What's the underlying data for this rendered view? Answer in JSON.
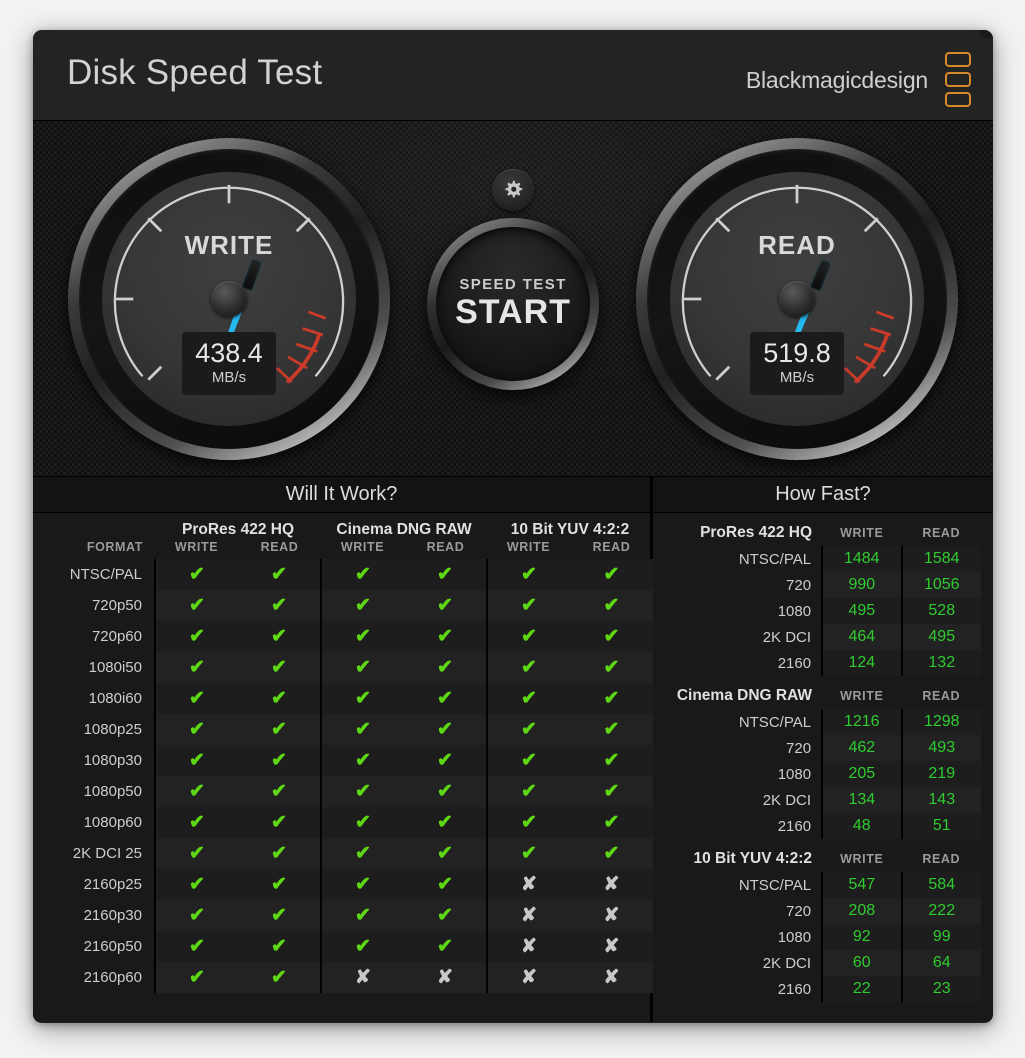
{
  "window": {
    "title": "Disk Speed Test",
    "brand": "Blackmagicdesign",
    "close_label": "✕"
  },
  "gauges": {
    "write": {
      "label": "WRITE",
      "value": "438.4",
      "unit": "MB/s",
      "needle_angle_deg": 200
    },
    "read": {
      "label": "READ",
      "value": "519.8",
      "unit": "MB/s",
      "needle_angle_deg": 202
    }
  },
  "controls": {
    "settings_icon": "gear-icon",
    "start_sub_label": "SPEED TEST",
    "start_main_label": "START"
  },
  "will_it_work": {
    "heading": "Will It Work?",
    "format_header": "FORMAT",
    "groups": [
      "ProRes 422 HQ",
      "Cinema DNG RAW",
      "10 Bit YUV 4:2:2"
    ],
    "sub_headers": [
      "WRITE",
      "READ"
    ],
    "pass_glyph": "✔",
    "fail_glyph": "✘",
    "rows": [
      {
        "format": "NTSC/PAL",
        "cells": [
          true,
          true,
          true,
          true,
          true,
          true
        ]
      },
      {
        "format": "720p50",
        "cells": [
          true,
          true,
          true,
          true,
          true,
          true
        ]
      },
      {
        "format": "720p60",
        "cells": [
          true,
          true,
          true,
          true,
          true,
          true
        ]
      },
      {
        "format": "1080i50",
        "cells": [
          true,
          true,
          true,
          true,
          true,
          true
        ]
      },
      {
        "format": "1080i60",
        "cells": [
          true,
          true,
          true,
          true,
          true,
          true
        ]
      },
      {
        "format": "1080p25",
        "cells": [
          true,
          true,
          true,
          true,
          true,
          true
        ]
      },
      {
        "format": "1080p30",
        "cells": [
          true,
          true,
          true,
          true,
          true,
          true
        ]
      },
      {
        "format": "1080p50",
        "cells": [
          true,
          true,
          true,
          true,
          true,
          true
        ]
      },
      {
        "format": "1080p60",
        "cells": [
          true,
          true,
          true,
          true,
          true,
          true
        ]
      },
      {
        "format": "2K DCI 25",
        "cells": [
          true,
          true,
          true,
          true,
          true,
          true
        ]
      },
      {
        "format": "2160p25",
        "cells": [
          true,
          true,
          true,
          true,
          false,
          false
        ]
      },
      {
        "format": "2160p30",
        "cells": [
          true,
          true,
          true,
          true,
          false,
          false
        ]
      },
      {
        "format": "2160p50",
        "cells": [
          true,
          true,
          true,
          true,
          false,
          false
        ]
      },
      {
        "format": "2160p60",
        "cells": [
          true,
          true,
          false,
          false,
          false,
          false
        ]
      }
    ]
  },
  "how_fast": {
    "heading": "How Fast?",
    "write_header": "WRITE",
    "read_header": "READ",
    "sections": [
      {
        "title": "ProRes 422 HQ",
        "rows": [
          {
            "format": "NTSC/PAL",
            "write": "1484",
            "read": "1584"
          },
          {
            "format": "720",
            "write": "990",
            "read": "1056"
          },
          {
            "format": "1080",
            "write": "495",
            "read": "528"
          },
          {
            "format": "2K DCI",
            "write": "464",
            "read": "495"
          },
          {
            "format": "2160",
            "write": "124",
            "read": "132"
          }
        ]
      },
      {
        "title": "Cinema DNG RAW",
        "rows": [
          {
            "format": "NTSC/PAL",
            "write": "1216",
            "read": "1298"
          },
          {
            "format": "720",
            "write": "462",
            "read": "493"
          },
          {
            "format": "1080",
            "write": "205",
            "read": "219"
          },
          {
            "format": "2K DCI",
            "write": "134",
            "read": "143"
          },
          {
            "format": "2160",
            "write": "48",
            "read": "51"
          }
        ]
      },
      {
        "title": "10 Bit YUV 4:2:2",
        "rows": [
          {
            "format": "NTSC/PAL",
            "write": "547",
            "read": "584"
          },
          {
            "format": "720",
            "write": "208",
            "read": "222"
          },
          {
            "format": "1080",
            "write": "92",
            "read": "99"
          },
          {
            "format": "2K DCI",
            "write": "60",
            "read": "64"
          },
          {
            "format": "2160",
            "write": "22",
            "read": "23"
          }
        ]
      }
    ]
  },
  "colors": {
    "accent_orange": "#d7882a",
    "needle_blue": "#2ec0f5",
    "pass_green": "#5ed715",
    "value_green": "#2fcc2f",
    "redline": "#cc3b2a"
  }
}
